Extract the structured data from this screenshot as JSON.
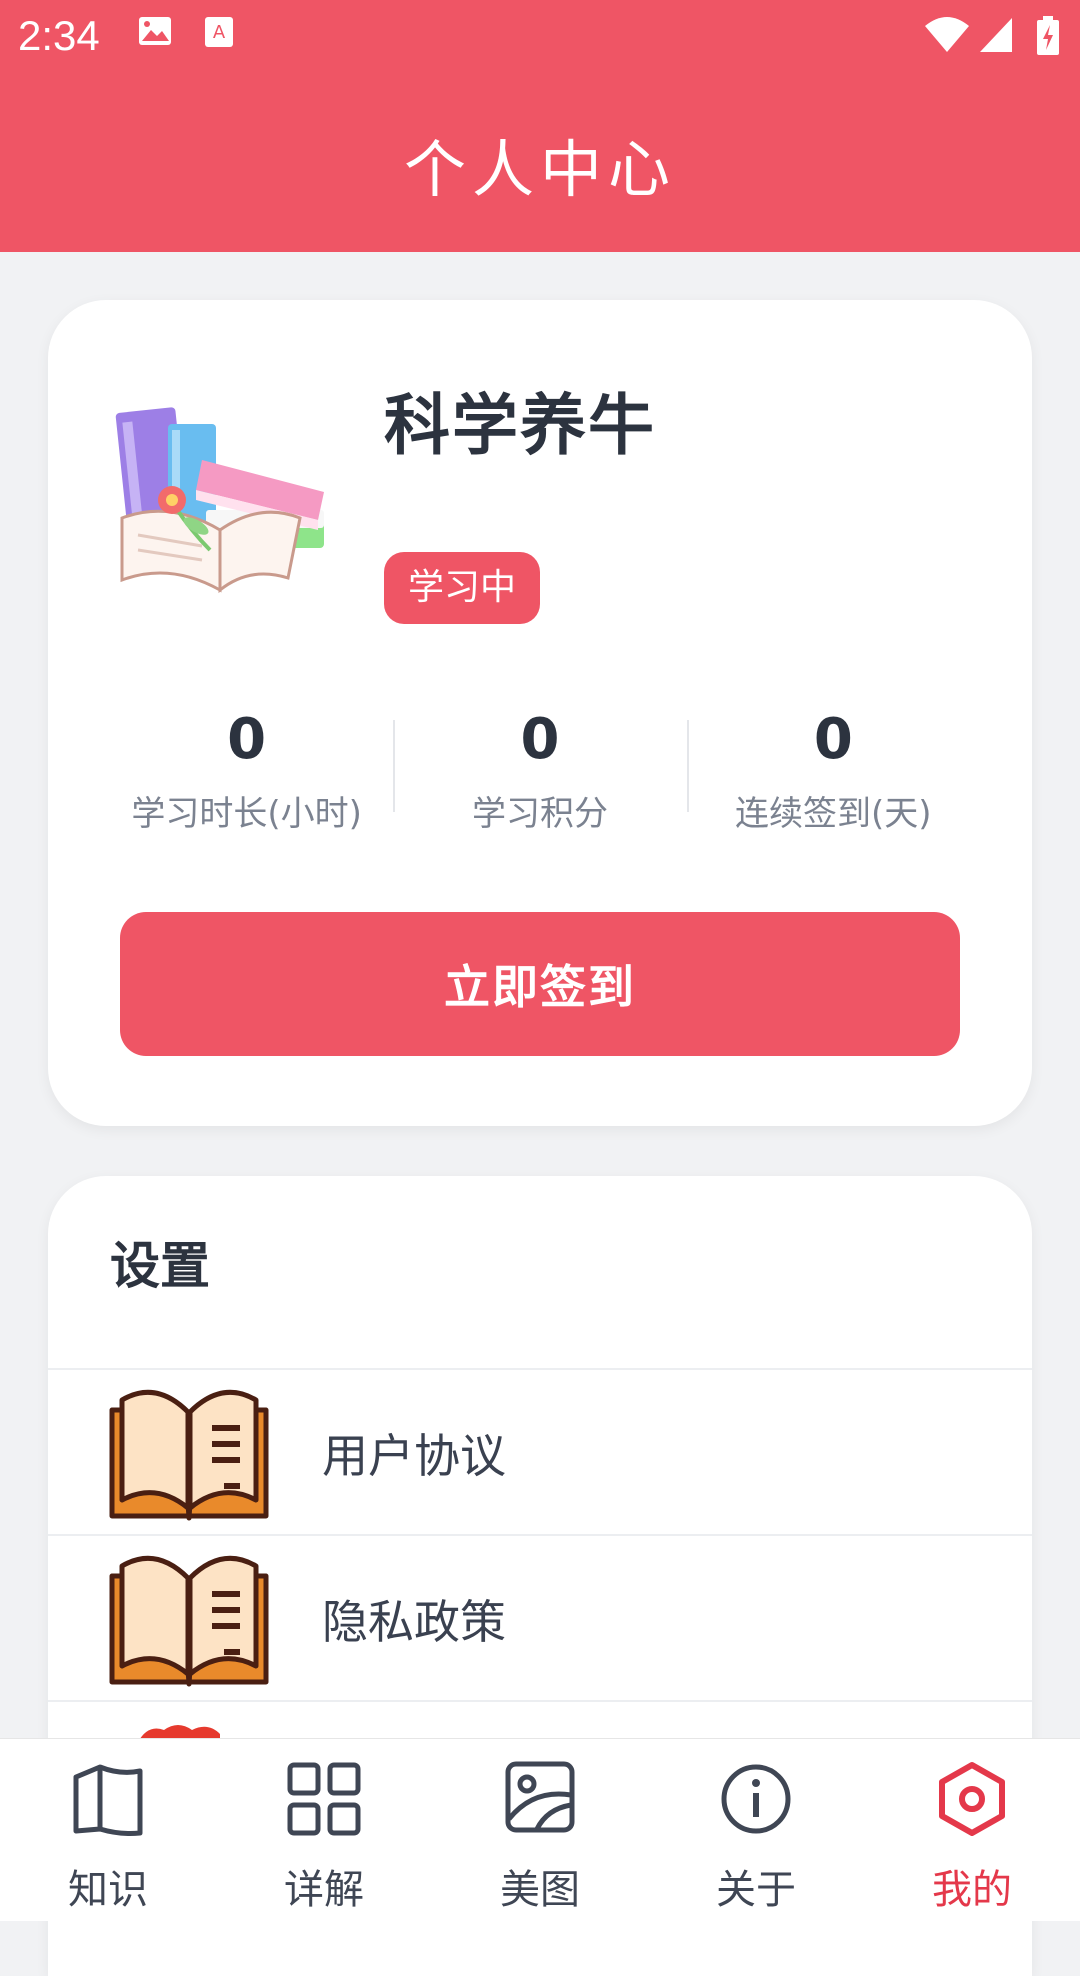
{
  "status_bar": {
    "time": "2:34"
  },
  "header": {
    "title": "个人中心"
  },
  "profile": {
    "name": "科学养牛",
    "badge": "学习中",
    "stats": [
      {
        "value": "0",
        "label": "学习时长(小时)"
      },
      {
        "value": "0",
        "label": "学习积分"
      },
      {
        "value": "0",
        "label": "连续签到(天)"
      }
    ],
    "checkin_label": "立即签到"
  },
  "settings": {
    "title": "设置",
    "items": [
      {
        "label": "用户协议",
        "icon": "book-icon"
      },
      {
        "label": "隐私政策",
        "icon": "book-icon"
      }
    ]
  },
  "bottom_nav": {
    "items": [
      {
        "label": "知识",
        "icon": "book-open-icon",
        "active": false
      },
      {
        "label": "详解",
        "icon": "grid-icon",
        "active": false
      },
      {
        "label": "美图",
        "icon": "image-icon",
        "active": false
      },
      {
        "label": "关于",
        "icon": "info-icon",
        "active": false
      },
      {
        "label": "我的",
        "icon": "hexagon-settings-icon",
        "active": true
      }
    ]
  },
  "colors": {
    "primary": "#ef5565",
    "text": "#2c333f",
    "muted": "#7b8290",
    "background": "#f1f2f4"
  }
}
